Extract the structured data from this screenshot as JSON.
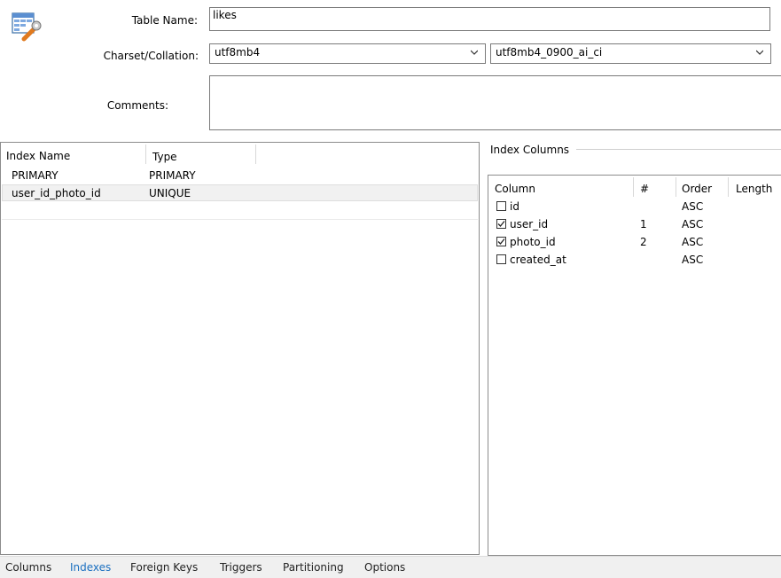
{
  "form": {
    "table_name_label": "Table Name:",
    "table_name_value": "likes",
    "charset_label": "Charset/Collation:",
    "charset_value": "utf8mb4",
    "collation_value": "utf8mb4_0900_ai_ci",
    "comments_label": "Comments:",
    "comments_value": ""
  },
  "index_table": {
    "headers": [
      "Index Name",
      "Type"
    ],
    "rows": [
      {
        "name": "PRIMARY",
        "type": "PRIMARY",
        "selected": false
      },
      {
        "name": "user_id_photo_id",
        "type": "UNIQUE",
        "selected": true
      }
    ]
  },
  "index_columns": {
    "title": "Index Columns",
    "headers": [
      "Column",
      "#",
      "Order",
      "Length"
    ],
    "rows": [
      {
        "column": "id",
        "checked": false,
        "num": "",
        "order": "ASC",
        "length": ""
      },
      {
        "column": "user_id",
        "checked": true,
        "num": "1",
        "order": "ASC",
        "length": ""
      },
      {
        "column": "photo_id",
        "checked": true,
        "num": "2",
        "order": "ASC",
        "length": ""
      },
      {
        "column": "created_at",
        "checked": false,
        "num": "",
        "order": "ASC",
        "length": ""
      }
    ]
  },
  "tabs": [
    {
      "label": "Columns",
      "active": false
    },
    {
      "label": "Indexes",
      "active": true
    },
    {
      "label": "Foreign Keys",
      "active": false
    },
    {
      "label": "Triggers",
      "active": false
    },
    {
      "label": "Partitioning",
      "active": false
    },
    {
      "label": "Options",
      "active": false
    }
  ],
  "colors": {
    "active_tab": "#1a6fc0",
    "tabbar_bg": "#f0f0f0",
    "selected_row_bg": "#f1f1f1"
  },
  "icons": {
    "table_icon": "table-wrench-icon",
    "chevron": "chevron-down-icon",
    "checkbox": "checkbox-icon"
  }
}
